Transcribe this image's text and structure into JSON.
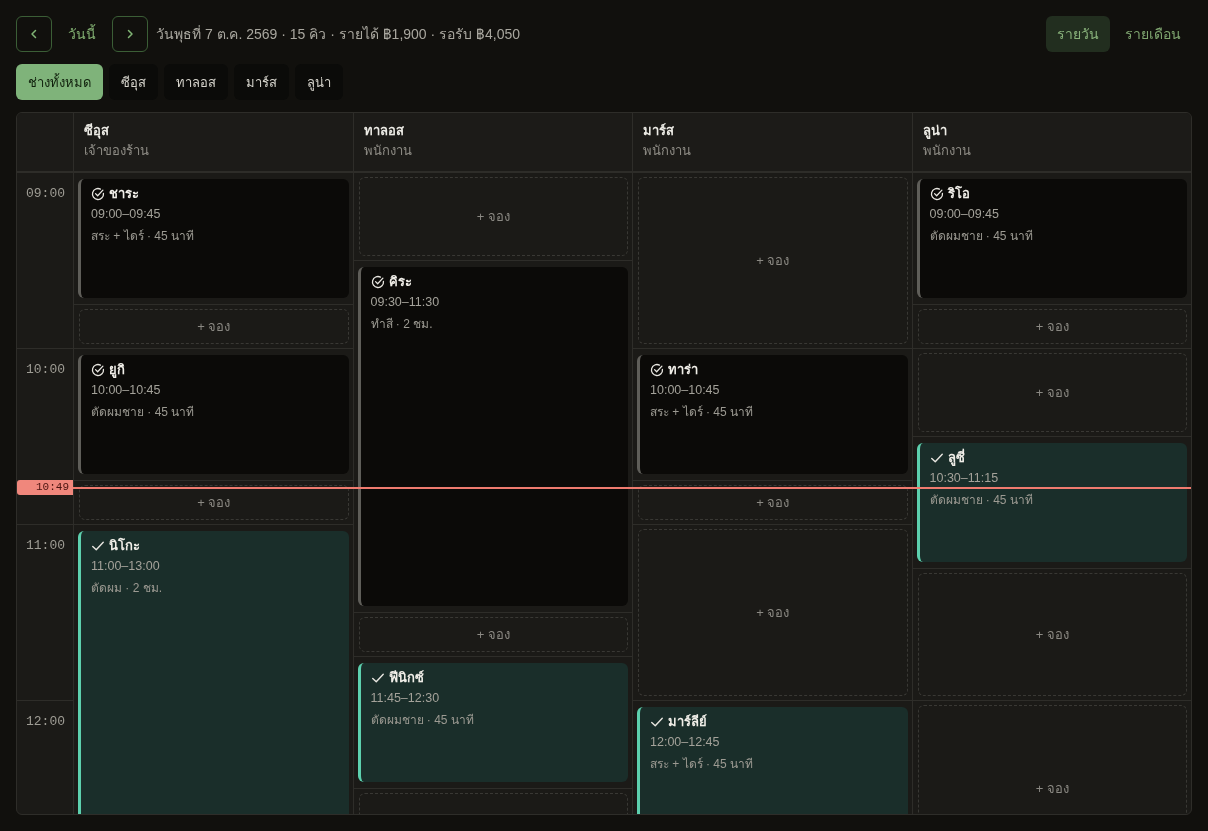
{
  "toolbar": {
    "today": "วันนี้",
    "summary": "วันพุธที่ 7 ต.ค. 2569 · 15 คิว · รายได้ ฿1,900 · รอรับ ฿4,050",
    "view_tabs": [
      {
        "label": "รายวัน",
        "selected": true
      },
      {
        "label": "รายเดือน",
        "selected": false
      }
    ]
  },
  "staff_filter": [
    {
      "label": "ช่างทั้งหมด",
      "selected": true
    },
    {
      "label": "ซีอุส",
      "selected": false
    },
    {
      "label": "ทาลอส",
      "selected": false
    },
    {
      "label": "มาร์ส",
      "selected": false
    },
    {
      "label": "ลูน่า",
      "selected": false
    }
  ],
  "schedule": {
    "hours": [
      "09:00",
      "10:00",
      "11:00",
      "12:00"
    ],
    "now": "10:49",
    "columns": [
      {
        "name": "ซีอุส",
        "role": "เจ้าของร้าน",
        "slots": [
          {
            "kind": "appointment",
            "completed": true,
            "customer": "ชาระ",
            "time": "09:00–09:45",
            "service": "สระ + ไดร์ · 45 นาที"
          },
          {
            "kind": "open",
            "label": "+ จอง"
          },
          {
            "kind": "appointment",
            "completed": true,
            "customer": "ยูกิ",
            "time": "10:00–10:45",
            "service": "ตัดผมชาย · 45 นาที"
          },
          {
            "kind": "open",
            "label": "+ จอง"
          },
          {
            "kind": "appointment",
            "completed": false,
            "customer": "นิโกะ",
            "time": "11:00–13:00",
            "service": "ตัดผม · 2 ชม."
          }
        ]
      },
      {
        "name": "ทาลอส",
        "role": "พนักงาน",
        "slots": [
          {
            "kind": "open",
            "label": "+ จอง"
          },
          {
            "kind": "appointment",
            "completed": true,
            "customer": "คิระ",
            "time": "09:30–11:30",
            "service": "ทำสี · 2 ชม."
          },
          {
            "kind": "open",
            "label": "+ จอง"
          },
          {
            "kind": "appointment",
            "completed": false,
            "customer": "ฟีนิกซ์",
            "time": "11:45–12:30",
            "service": "ตัดผมชาย · 45 นาที"
          },
          {
            "kind": "open"
          }
        ]
      },
      {
        "name": "มาร์ส",
        "role": "พนักงาน",
        "slots": [
          {
            "kind": "open",
            "label": "+ จอง"
          },
          {
            "kind": "appointment",
            "completed": true,
            "customer": "ทาร่า",
            "time": "10:00–10:45",
            "service": "สระ + ไดร์ · 45 นาที"
          },
          {
            "kind": "open",
            "label": "+ จอง"
          },
          {
            "kind": "open",
            "label": "+ จอง"
          },
          {
            "kind": "appointment",
            "completed": false,
            "customer": "มาร์ลีย์",
            "time": "12:00–12:45",
            "service": "สระ + ไดร์ · 45 นาที"
          }
        ]
      },
      {
        "name": "ลูน่า",
        "role": "พนักงาน",
        "slots": [
          {
            "kind": "appointment",
            "completed": true,
            "customer": "ริโอ",
            "time": "09:00–09:45",
            "service": "ตัดผมชาย · 45 นาที"
          },
          {
            "kind": "open",
            "label": "+ จอง"
          },
          {
            "kind": "open",
            "label": "+ จอง"
          },
          {
            "kind": "appointment",
            "completed": false,
            "customer": "ลูซี่",
            "time": "10:30–11:15",
            "service": "ตัดผมชาย · 45 นาที"
          },
          {
            "kind": "open",
            "label": "+ จอง"
          },
          {
            "kind": "open",
            "label": "+ จอง"
          }
        ]
      }
    ]
  }
}
